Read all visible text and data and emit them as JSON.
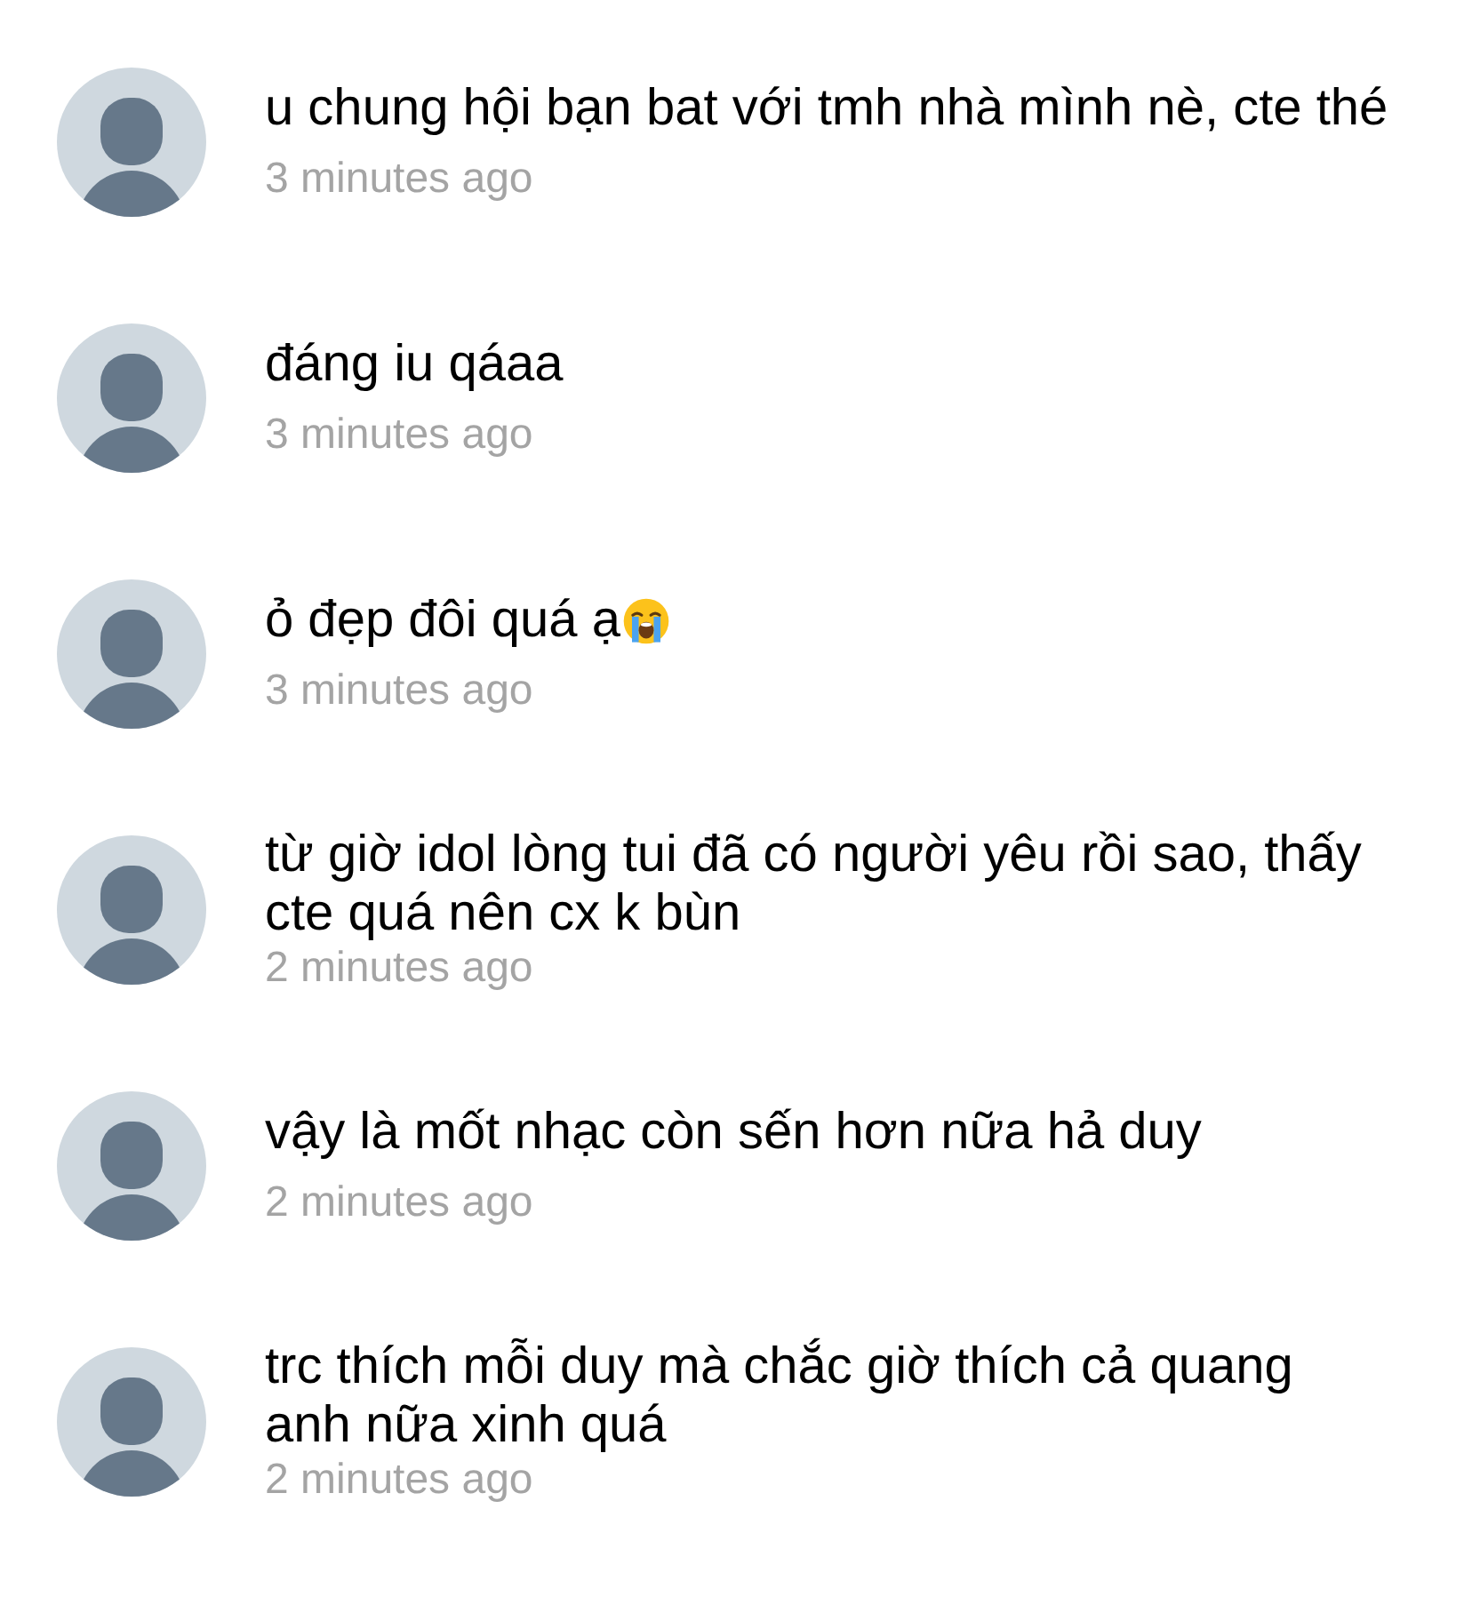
{
  "comments": [
    {
      "lines": [
        "u chung hội bạn bat với tmh nhà mình nè, cte thé"
      ],
      "trailing_icon": false,
      "time": "3 minutes ago"
    },
    {
      "lines": [
        "đáng iu qáaa"
      ],
      "trailing_icon": false,
      "time": "3 minutes ago"
    },
    {
      "lines": [
        "ỏ đẹp đôi quá ạ"
      ],
      "trailing_icon": true,
      "time": "3 minutes ago"
    },
    {
      "lines": [
        "từ giờ idol lòng tui đã có người yêu rồi sao, thấy",
        "cte quá nên cx k bùn"
      ],
      "trailing_icon": false,
      "time": "2 minutes ago"
    },
    {
      "lines": [
        "vậy là mốt nhạc còn sến hơn nữa hả duy"
      ],
      "trailing_icon": false,
      "time": "2 minutes ago"
    },
    {
      "lines": [
        "trc thích mỗi duy mà chắc giờ thích cả quang",
        "anh nữa xinh quá"
      ],
      "trailing_icon": false,
      "time": "2 minutes ago"
    }
  ]
}
